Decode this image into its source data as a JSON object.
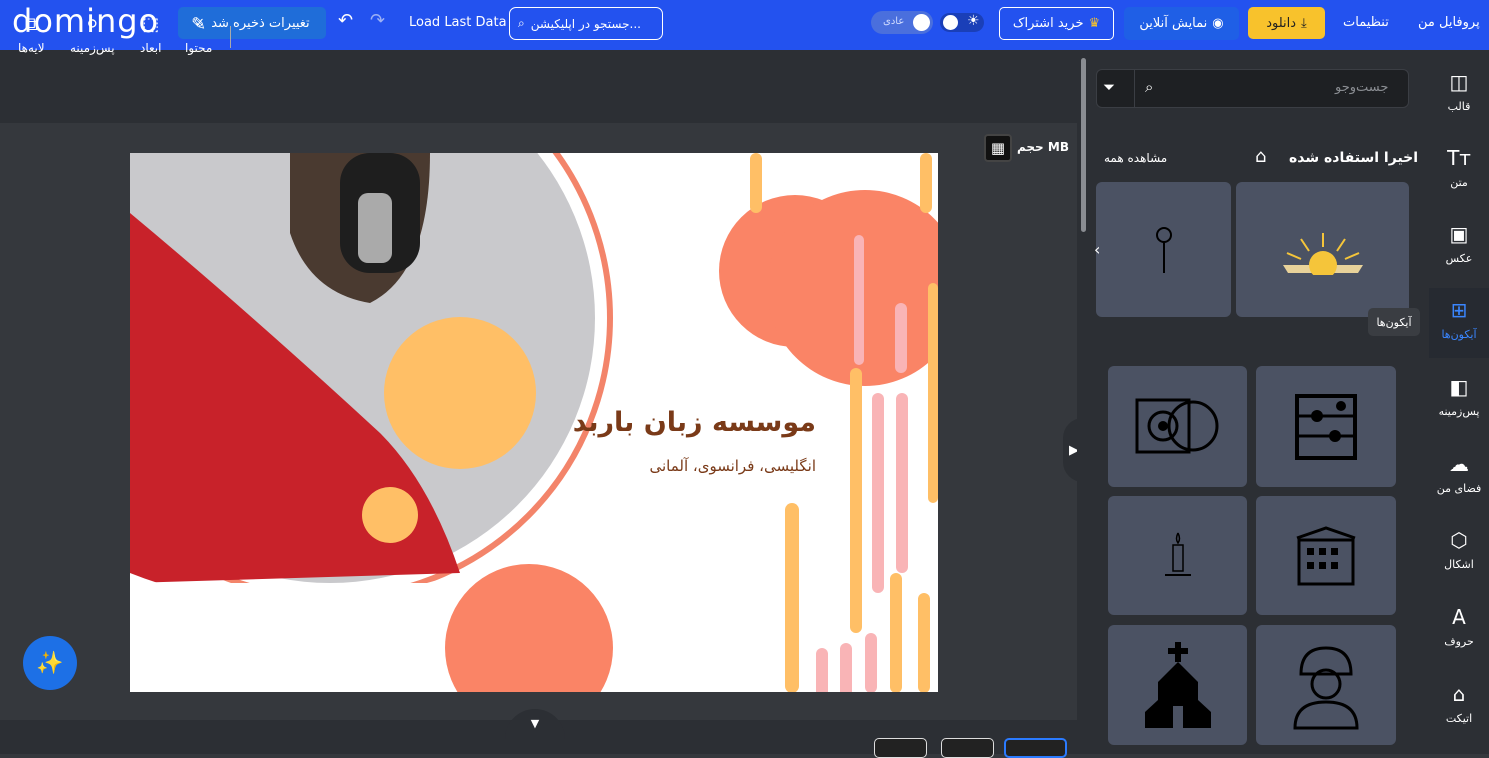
{
  "header": {
    "logo": "domingo",
    "save_label": "تغییرات ذخیره شد",
    "load_label": "Load Last Data",
    "search_placeholder": "جستجو در اپلیکیشن...",
    "mode_label": "عادی",
    "subscribe_label": "خرید اشتراک",
    "online_label": "نمایش آنلاین",
    "download_label": "دانلود",
    "settings_label": "تنظیمات",
    "profile_label": "پروفایل من"
  },
  "toolbar": {
    "layers": "لایه‌ها",
    "background": "پس‌زمینه",
    "dimensions": "ابعاد",
    "content": "محتوا"
  },
  "canvas": {
    "size_label": "حجم MB",
    "design_title": "موسسه زبان باربد",
    "design_subtitle": "انگلیسی، فرانسوی، آلمانی"
  },
  "panel": {
    "search_placeholder": "جست‌وجو",
    "recent_title": "اخیرا استفاده شده",
    "see_all": "مشاهده همه",
    "tooltip": "آیکون‌ها"
  },
  "sidebar": {
    "items": [
      {
        "label": "قالب",
        "icon": "template-icon"
      },
      {
        "label": "متن",
        "icon": "text-icon"
      },
      {
        "label": "عکس",
        "icon": "photo-icon"
      },
      {
        "label": "آیکون‌ها",
        "icon": "icons-icon"
      },
      {
        "label": "پس‌زمینه",
        "icon": "background-icon"
      },
      {
        "label": "فضای من",
        "icon": "upload-icon"
      },
      {
        "label": "اشکال",
        "icon": "shapes-icon"
      },
      {
        "label": "حروف",
        "icon": "letters-icon"
      },
      {
        "label": "اتیکت",
        "icon": "tag-icon"
      }
    ]
  },
  "colors": {
    "brand": "#2352ef",
    "download": "#f8c22c",
    "active": "#3a86ff"
  }
}
